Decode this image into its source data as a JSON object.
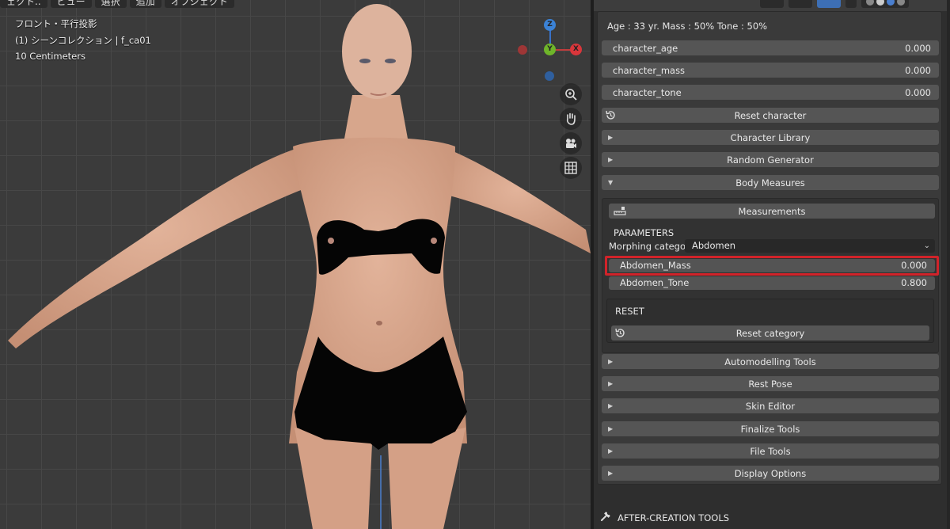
{
  "top_menu": [
    "ェクト..",
    "ビュー",
    "選択",
    "追加",
    "オブジェクト"
  ],
  "viewport": {
    "view_name": "フロント・平行投影",
    "collection": "(1) シーンコレクション | f_ca01",
    "scale": "10 Centimeters",
    "gizmo": {
      "z": "Z",
      "y": "Y",
      "x": "X"
    },
    "nav_icons": [
      "zoom-icon",
      "hand-pan-icon",
      "camera-icon",
      "grid-icon"
    ]
  },
  "panel": {
    "info": "Age : 33 yr.  Mass : 50%  Tone : 50%",
    "params": [
      {
        "label": "character_age",
        "value": "0.000"
      },
      {
        "label": "character_mass",
        "value": "0.000"
      },
      {
        "label": "character_tone",
        "value": "0.000"
      }
    ],
    "reset_character": "Reset character",
    "sections_top": [
      "Character Library",
      "Random Generator"
    ],
    "body_measures": "Body Measures",
    "measurements": "Measurements",
    "parameters_label": "PARAMETERS",
    "morphing_label": "Morphing categor..",
    "morphing_value": "Abdomen",
    "sliders": [
      {
        "label": "Abdomen_Mass",
        "value": "0.000"
      },
      {
        "label": "Abdomen_Tone",
        "value": "0.800"
      }
    ],
    "reset_label": "RESET",
    "reset_category": "Reset category",
    "sections_bottom": [
      "Automodelling Tools",
      "Rest Pose",
      "Skin Editor",
      "Finalize Tools",
      "File Tools",
      "Display Options"
    ],
    "after_creation": "AFTER-CREATION TOOLS"
  },
  "colors": {
    "highlight": "#d1232a",
    "gizmo_x": "#d9363b",
    "gizmo_y": "#6fb52a",
    "gizmo_z": "#3b82d6"
  }
}
